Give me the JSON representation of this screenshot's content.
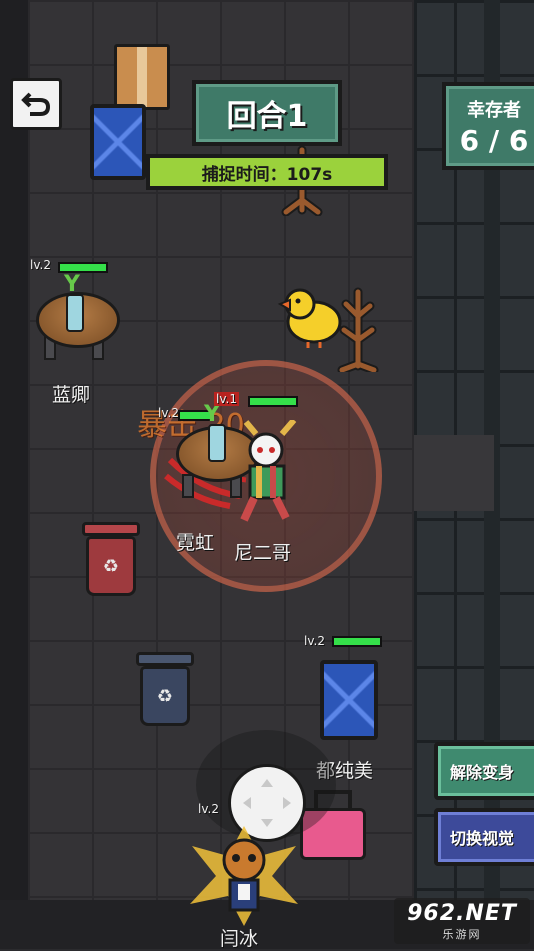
{
  "hud": {
    "round_label": "回合1",
    "catch_timer": "捕捉时间：107s",
    "survivor_label": "幸存者",
    "survivor_count": "6 / 6"
  },
  "actions": {
    "undisguise_label": "解除变身",
    "switch_view_label": "切换视觉"
  },
  "players": [
    {
      "name": "蓝卿",
      "level": "lv.2",
      "health_fraction": 1.0
    },
    {
      "name": "霓虹",
      "level": "lv.2",
      "health_fraction": 1.0
    },
    {
      "name": "尼二哥",
      "level": "lv.1",
      "health_fraction": 1.0
    },
    {
      "name": "都纯美",
      "level": "lv.2",
      "health_fraction": 1.0
    },
    {
      "name": "闫冰",
      "level": "lv.2",
      "health_fraction": 1.0
    }
  ],
  "effects": {
    "crit_text": "暴击 20"
  },
  "watermark": {
    "main": "962.NET",
    "sub": "乐游网"
  },
  "colors": {
    "hud_green": "#3f7a68",
    "timer_bar": "#9bd23c",
    "undisguise_button": "#3f8a6f",
    "switch_view_button": "#3d4a9a",
    "hp_bar": "#35e04a",
    "crit_text": "#e07a2e"
  },
  "icons": {
    "back": "back-arrow-icon",
    "recycle": "recycle-icon",
    "joystick": "joystick-icon"
  }
}
